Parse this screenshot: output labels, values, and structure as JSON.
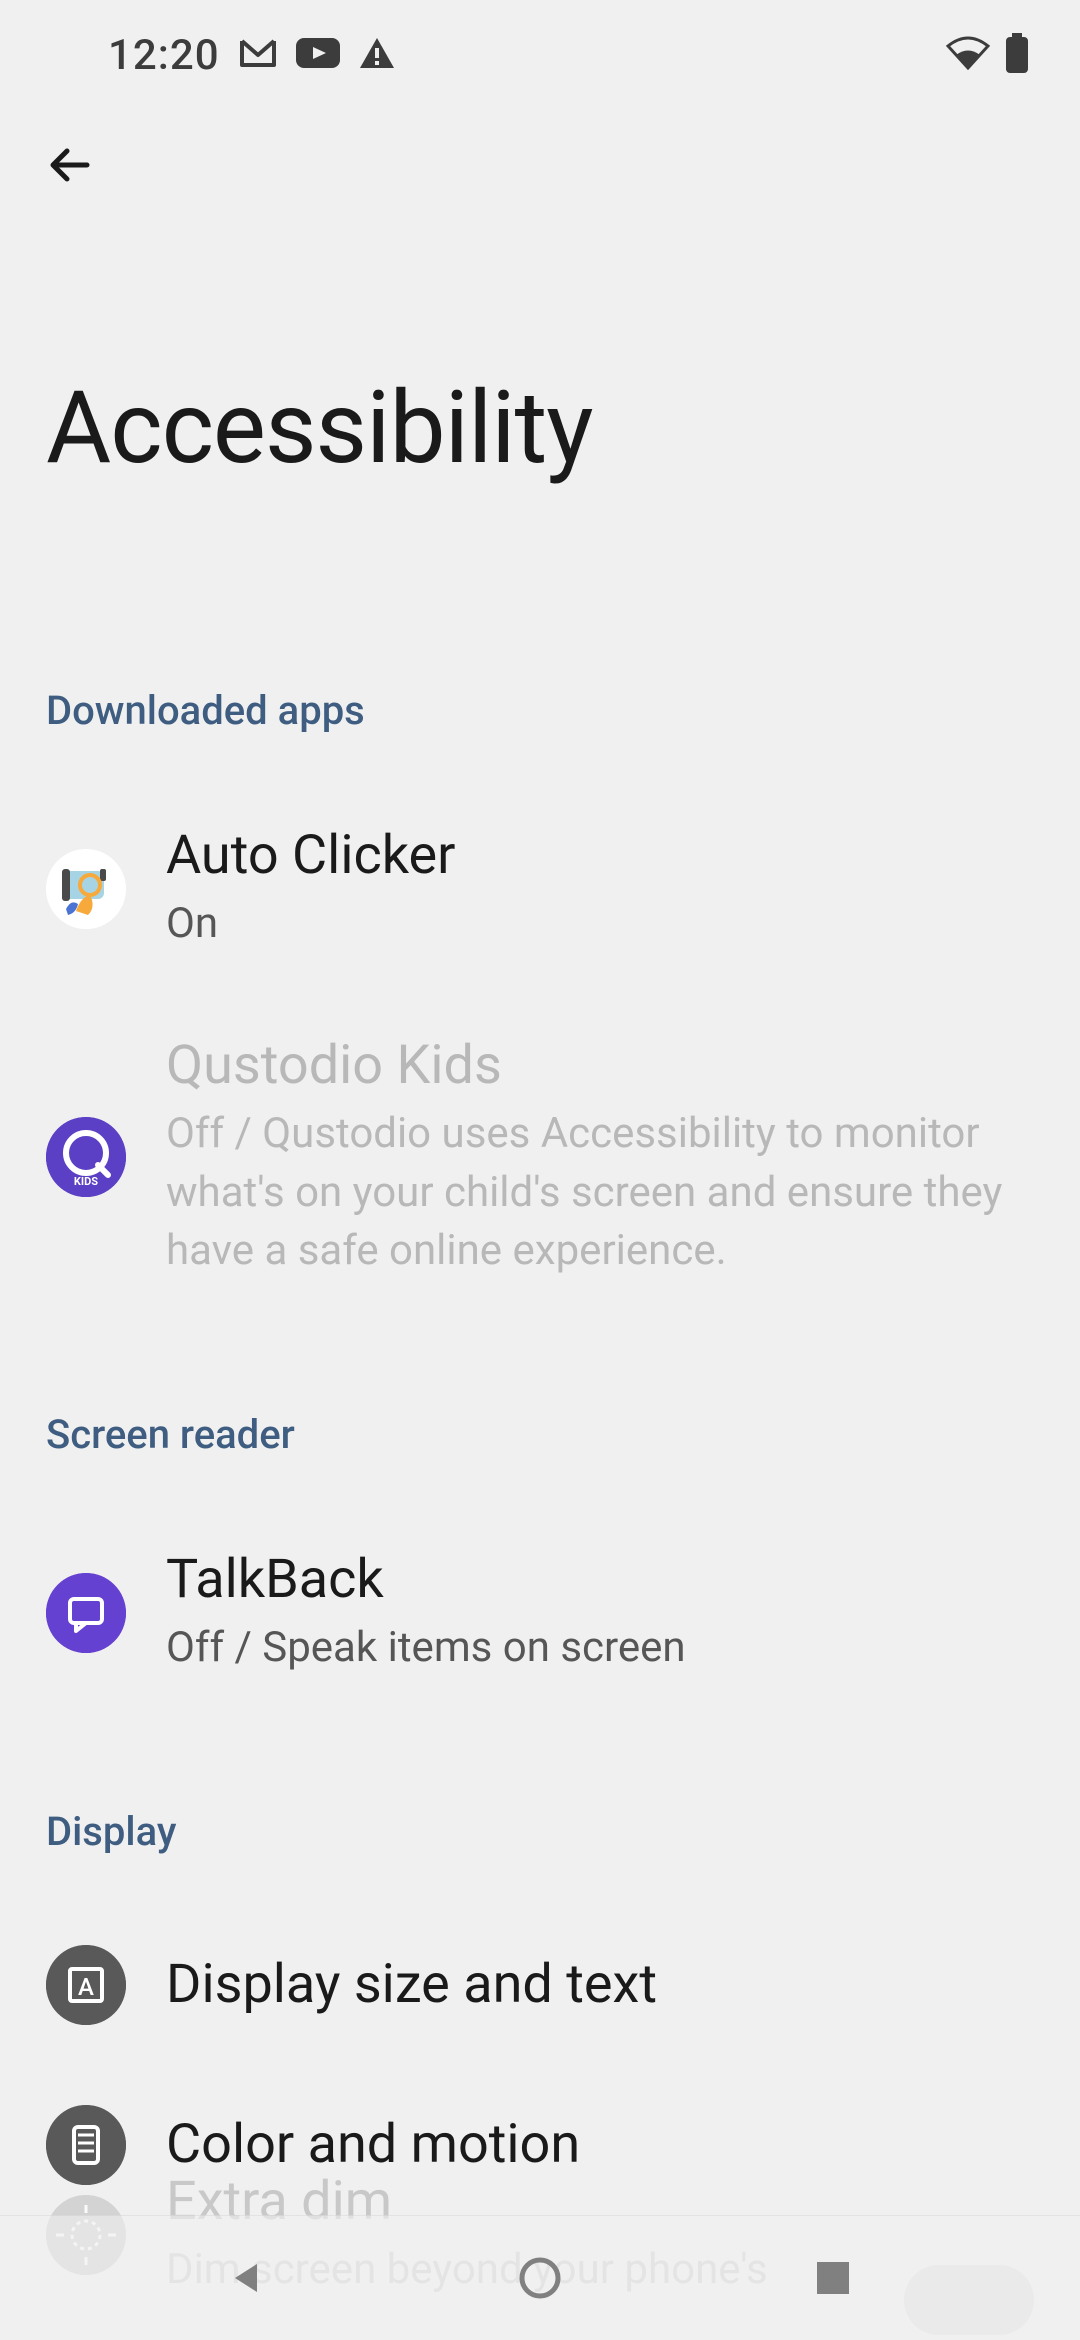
{
  "status": {
    "time": "12:20"
  },
  "page": {
    "title": "Accessibility"
  },
  "sections": {
    "downloaded": {
      "header": "Downloaded apps",
      "items": [
        {
          "title": "Auto Clicker",
          "subtitle": "On"
        },
        {
          "title": "Qustodio Kids",
          "subtitle": "Off / Qustodio uses Accessibility to monitor what's on your child's screen and ensure they have a safe online experience."
        }
      ]
    },
    "screenReader": {
      "header": "Screen reader",
      "items": [
        {
          "title": "TalkBack",
          "subtitle": "Off / Speak items on screen"
        }
      ]
    },
    "display": {
      "header": "Display",
      "items": [
        {
          "title": "Display size and text"
        },
        {
          "title": "Color and motion"
        },
        {
          "title": "Extra dim",
          "subtitle": "Dim screen beyond your phone's"
        }
      ]
    }
  }
}
